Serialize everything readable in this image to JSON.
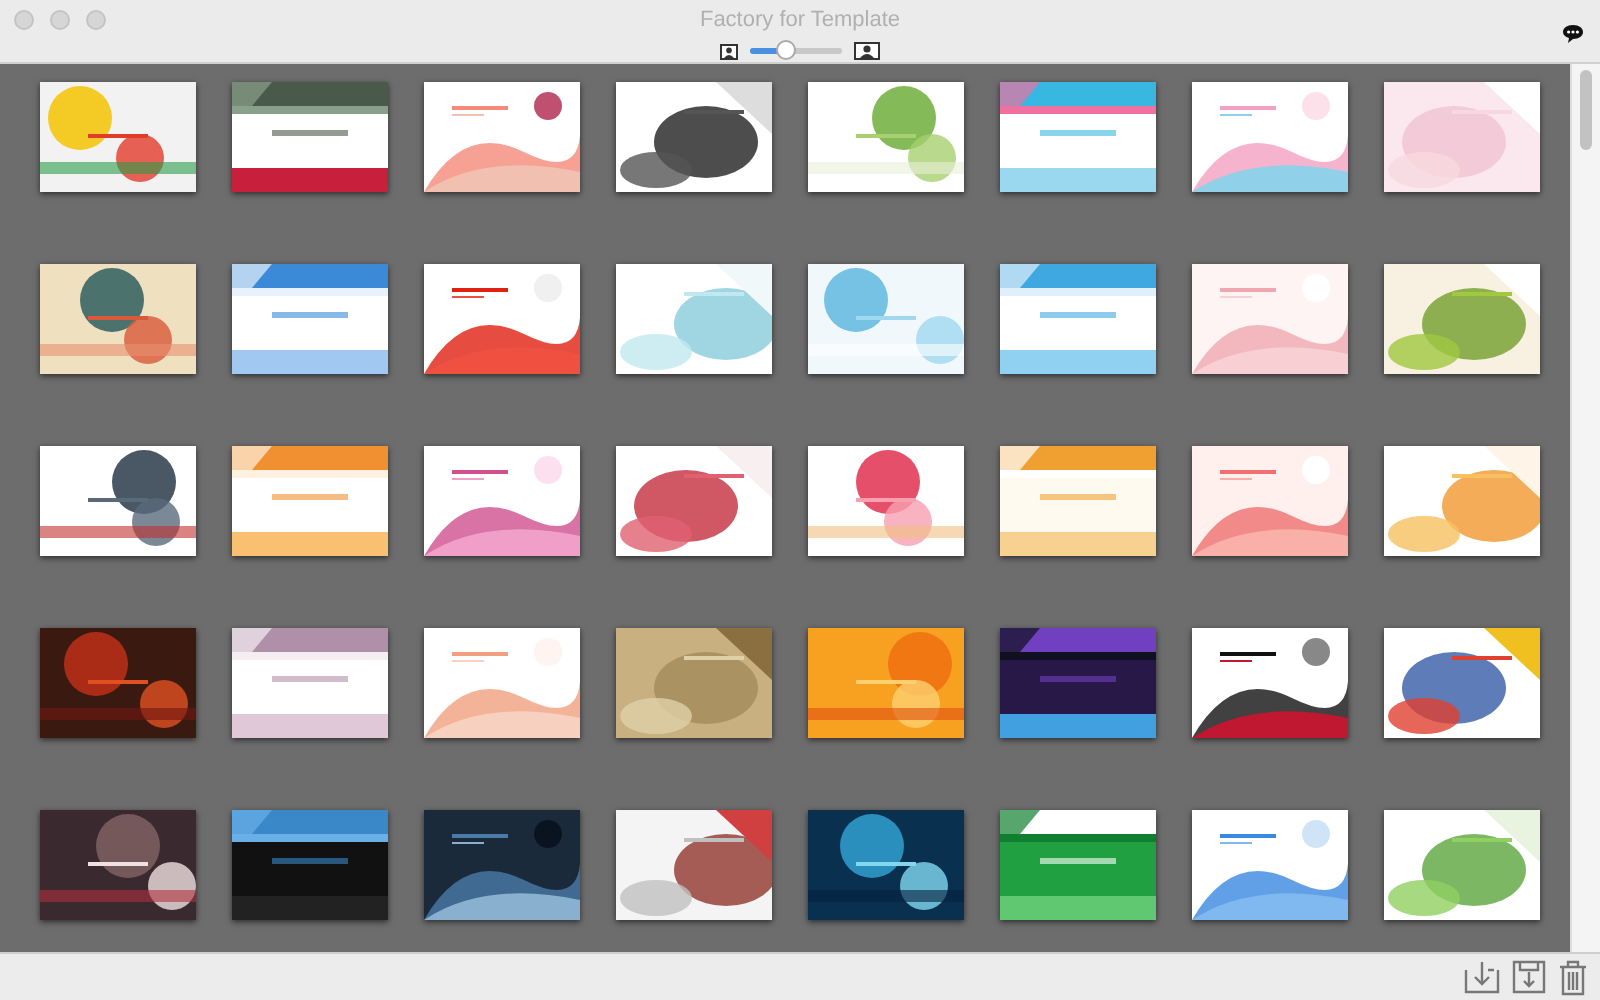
{
  "window": {
    "title": "Factory for Template"
  },
  "toolbar": {
    "size_slider": {
      "level": 0.4
    }
  }
}
